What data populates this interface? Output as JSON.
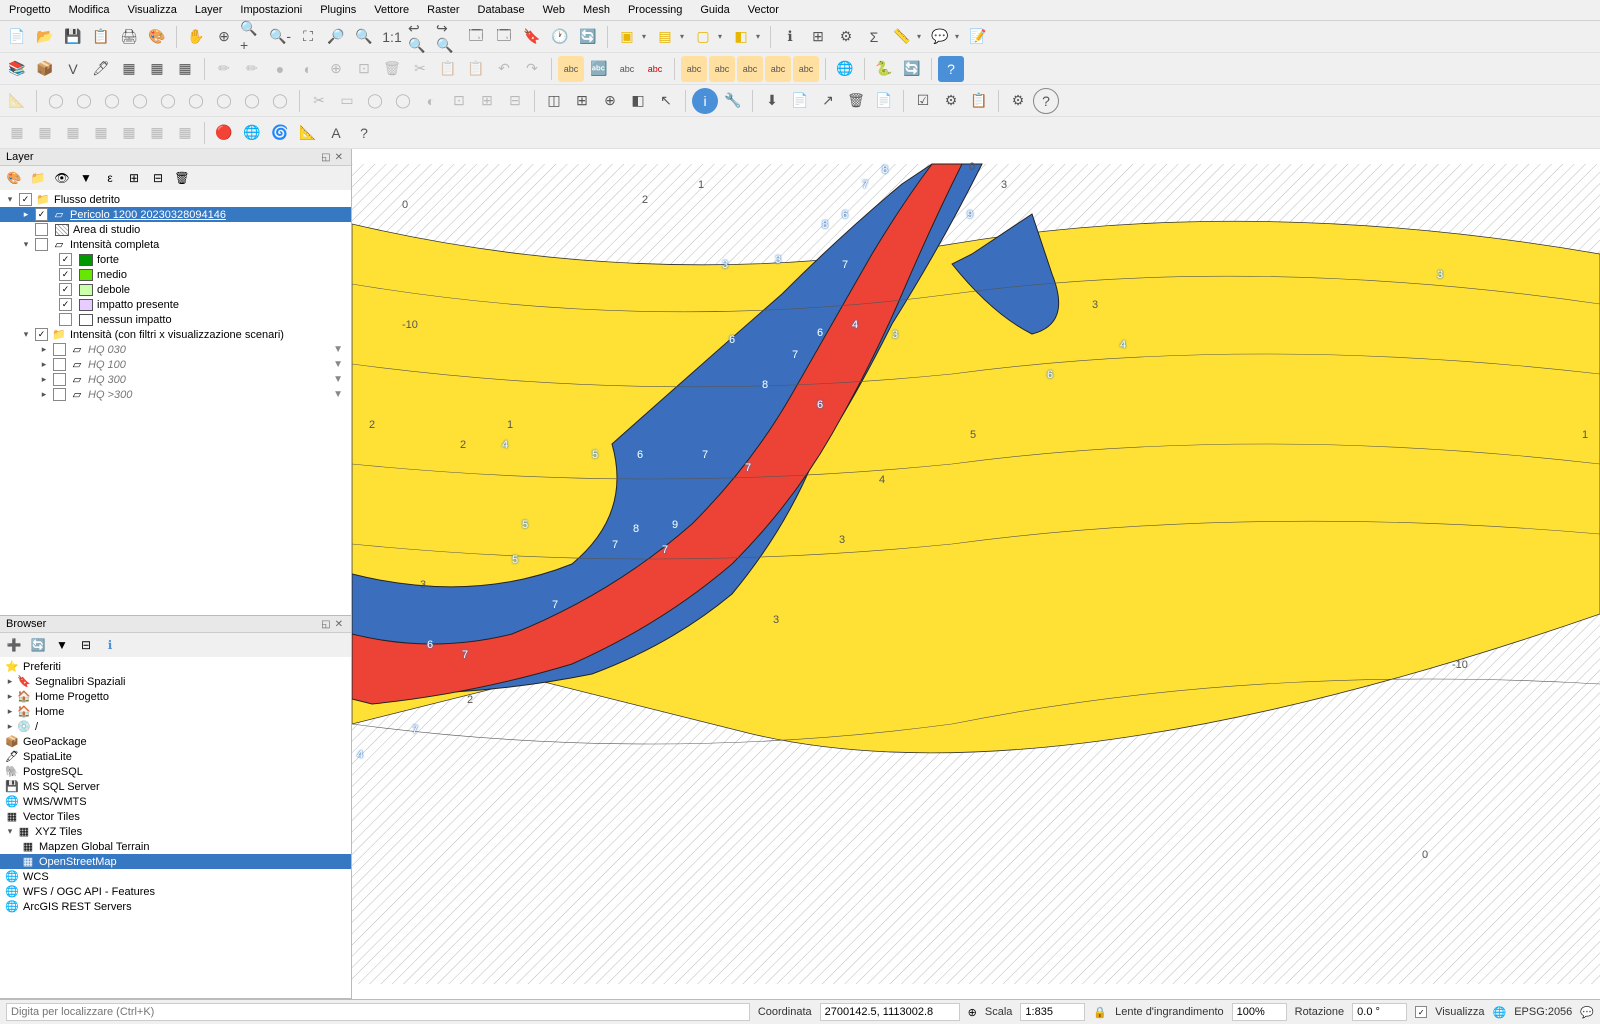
{
  "menu": [
    "Progetto",
    "Modifica",
    "Visualizza",
    "Layer",
    "Impostazioni",
    "Plugins",
    "Vettore",
    "Raster",
    "Database",
    "Web",
    "Mesh",
    "Processing",
    "Guida",
    "Vector"
  ],
  "panels": {
    "layers": {
      "title": "Layer",
      "tree": {
        "root": "Flusso detrito",
        "pericolo": "Pericolo 1200 20230328094146",
        "area": "Area di studio",
        "intensita_completa": "Intensità completa",
        "forte": "forte",
        "medio": "medio",
        "debole": "debole",
        "impatto_presente": "impatto presente",
        "nessun_impatto": "nessun impatto",
        "intensita_filtri": "Intensità (con filtri x visualizzazione scenari)",
        "hq030": "HQ 030",
        "hq100": "HQ 100",
        "hq300": "HQ 300",
        "hq_gt300": "HQ >300"
      }
    },
    "browser": {
      "title": "Browser",
      "items": {
        "preferiti": "Preferiti",
        "segnalibri": "Segnalibri Spaziali",
        "home_progetto": "Home Progetto",
        "home": "Home",
        "root": "/",
        "geopackage": "GeoPackage",
        "spatialite": "SpatiaLite",
        "postgresql": "PostgreSQL",
        "mssql": "MS SQL Server",
        "wms": "WMS/WMTS",
        "vector_tiles": "Vector Tiles",
        "xyz": "XYZ Tiles",
        "mapzen": "Mapzen Global Terrain",
        "osm": "OpenStreetMap",
        "wcs": "WCS",
        "wfs": "WFS / OGC API - Features",
        "arcgis": "ArcGIS REST Servers"
      }
    }
  },
  "colors": {
    "forte": "#009900",
    "medio": "#66e600",
    "debole": "#ccffaa",
    "impatto": "#e6ccff",
    "nessun": "#ffffff",
    "map_yellow": "#ffe135",
    "map_blue": "#3b6fbd",
    "map_red": "#ed4337"
  },
  "statusbar": {
    "locator_placeholder": "Digita per localizzare (Ctrl+K)",
    "coord_label": "Coordinata",
    "coord_value": "2700142.5, 1113002.8",
    "scale_label": "Scala",
    "scale_value": "1:835",
    "magnifier_label": "Lente d'ingrandimento",
    "magnifier_value": "100%",
    "rotation_label": "Rotazione",
    "rotation_value": "0.0 °",
    "render_label": "Visualizza",
    "crs": "EPSG:2056"
  },
  "map_numbers": [
    "0",
    "0",
    "-10",
    "-10",
    "0",
    "1",
    "1",
    "1",
    "2",
    "2",
    "2",
    "2",
    "3",
    "3",
    "3",
    "3",
    "3",
    "3",
    "3",
    "3",
    "3",
    "4",
    "4",
    "4",
    "4",
    "4",
    "5",
    "5",
    "5",
    "5",
    "6",
    "6",
    "6",
    "6",
    "6",
    "6",
    "6",
    "7",
    "7",
    "7",
    "7",
    "7",
    "7",
    "7",
    "7",
    "7",
    "7",
    "8",
    "8",
    "8",
    "8",
    "9",
    "9"
  ]
}
